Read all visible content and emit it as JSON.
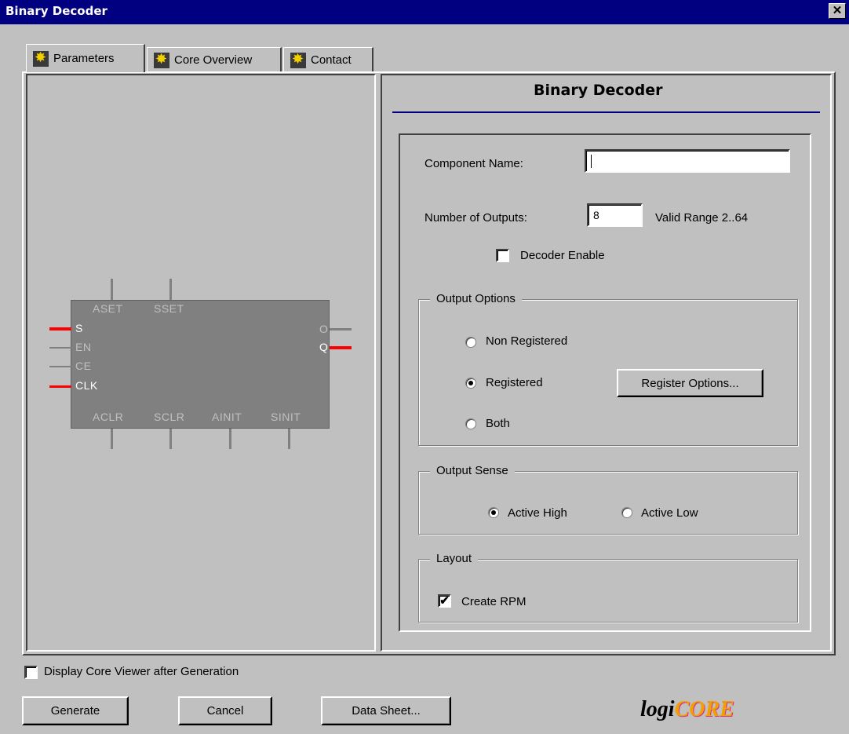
{
  "window": {
    "title": "Binary Decoder",
    "close_glyph": "✕"
  },
  "tabs": [
    {
      "label": "Parameters",
      "icon": "xilinx-core-icon",
      "active": true
    },
    {
      "label": "Core Overview",
      "icon": "xilinx-core-icon",
      "active": false
    },
    {
      "label": "Contact",
      "icon": "xilinx-core-icon",
      "active": false
    }
  ],
  "symbol": {
    "top_pins": [
      "ASET",
      "SSET"
    ],
    "bottom_pins": [
      "ACLR",
      "SCLR",
      "AINIT",
      "SINIT"
    ],
    "left_pins": [
      "S",
      "EN",
      "CE",
      "CLK"
    ],
    "right_pins": [
      "O",
      "Q"
    ],
    "active_pin_color": "#ff0000",
    "inactive_pin_color": "#808080"
  },
  "form": {
    "heading": "Binary Decoder",
    "component_name_label": "Component Name:",
    "component_name_value": "",
    "num_outputs_label": "Number of Outputs:",
    "num_outputs_value": "8",
    "valid_range": "Valid Range 2..64",
    "decoder_enable_label": "Decoder Enable",
    "decoder_enable_checked": false,
    "output_options": {
      "legend": "Output Options",
      "non_registered": "Non Registered",
      "registered": "Registered",
      "both": "Both",
      "selected": "Registered",
      "register_options_button": "Register Options..."
    },
    "output_sense": {
      "legend": "Output Sense",
      "active_high": "Active High",
      "active_low": "Active Low",
      "selected": "Active High"
    },
    "layout": {
      "legend": "Layout",
      "create_rpm_label": "Create RPM",
      "create_rpm_checked": true
    }
  },
  "footer": {
    "display_viewer_label": "Display Core Viewer after Generation",
    "display_viewer_checked": false,
    "generate": "Generate",
    "cancel": "Cancel",
    "data_sheet": "Data Sheet...",
    "logo_text_a": "logi",
    "logo_text_b": "CORE"
  },
  "colors": {
    "title_bar": "#000080",
    "heading_rule": "#000080",
    "dialog_bg": "#c0c0c0",
    "logo_orange": "#f0a000",
    "logo_pink": "#e0308a"
  }
}
